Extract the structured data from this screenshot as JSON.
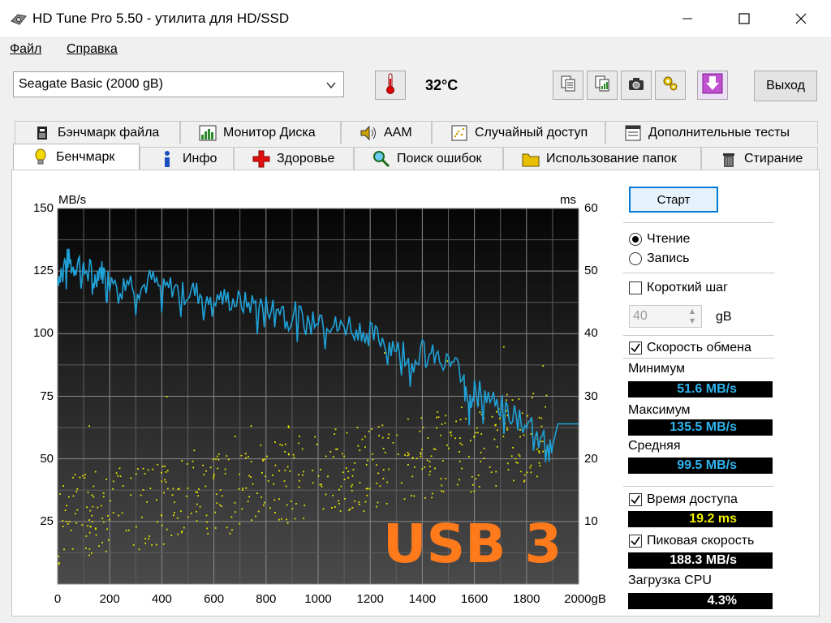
{
  "window": {
    "title": "HD Tune Pro 5.50 - утилита для HD/SSD"
  },
  "menu": {
    "file": "Файл",
    "help": "Справка"
  },
  "toolbar": {
    "drive": "Seagate Basic (2000 gB)",
    "temperature": "32°C",
    "exit": "Выход"
  },
  "tabs_top": [
    {
      "label": "Бэнчмарк файла",
      "icon": "file-benchmark-icon"
    },
    {
      "label": "Монитор Диска",
      "icon": "disk-monitor-icon"
    },
    {
      "label": "AAM",
      "icon": "speaker-icon"
    },
    {
      "label": "Случайный доступ",
      "icon": "random-access-icon"
    },
    {
      "label": "Дополнительные  тесты",
      "icon": "extra-tests-icon"
    }
  ],
  "tabs_bottom": [
    {
      "label": "Бенчмарк",
      "icon": "lightbulb-icon"
    },
    {
      "label": "Инфо",
      "icon": "info-icon"
    },
    {
      "label": "Здоровье",
      "icon": "health-cross-icon"
    },
    {
      "label": "Поиск ошибок",
      "icon": "magnifier-icon"
    },
    {
      "label": "Использование папок",
      "icon": "folder-icon"
    },
    {
      "label": "Стирание",
      "icon": "trash-icon"
    }
  ],
  "controls": {
    "start": "Старт",
    "read": "Чтение",
    "write": "Запись",
    "short_stroke": "Короткий шаг",
    "short_stroke_value": "40",
    "short_stroke_unit": "gB",
    "transfer_rate": "Скорость обмена"
  },
  "stats": {
    "min_label": "Минимум",
    "min": "51.6 MB/s",
    "max_label": "Максимум",
    "max": "135.5 MB/s",
    "avg_label": "Средняя",
    "avg": "99.5 MB/s",
    "access_label": "Время доступа",
    "access": "19.2 ms",
    "burst_label": "Пиковая скорость",
    "burst": "188.3 MB/s",
    "cpu_label": "Загрузка CPU",
    "cpu": "4.3%"
  },
  "watermark": "USB 3",
  "colors": {
    "transfer": "#1fa2d8",
    "access": "#e6e600",
    "chart_bg": "#333333",
    "stat_blue": "#2fb4ee",
    "stat_yellow": "#f0f000",
    "stat_white": "#ffffff"
  },
  "chart_data": {
    "type": "line",
    "y_unit": "MB/s",
    "y2_unit": "ms",
    "x_unit": "gB",
    "ylim": [
      0,
      150
    ],
    "y2lim": [
      0,
      60
    ],
    "xlim": [
      0,
      2000
    ],
    "y_ticks": [
      "150",
      "125",
      "100",
      "75",
      "50",
      "25"
    ],
    "y2_ticks": [
      "60",
      "50",
      "40",
      "30",
      "20",
      "10"
    ],
    "x_ticks": [
      "0",
      "200",
      "400",
      "600",
      "800",
      "1000",
      "1200",
      "1400",
      "1600",
      "1800",
      "2000gB"
    ],
    "grid": true,
    "series": [
      {
        "kind": "transfer",
        "x": [
          0,
          20,
          40,
          60,
          80,
          100,
          120,
          140,
          160,
          180,
          200,
          240,
          280,
          320,
          360,
          400,
          440,
          480,
          520,
          560,
          600,
          640,
          680,
          720,
          760,
          800,
          840,
          880,
          920,
          960,
          1000,
          1040,
          1080,
          1120,
          1160,
          1200,
          1240,
          1280,
          1320,
          1360,
          1400,
          1440,
          1480,
          1520,
          1560,
          1580,
          1600,
          1640,
          1680,
          1720,
          1760,
          1800,
          1840,
          1880,
          1900,
          1920,
          2000
        ],
        "values": [
          122,
          127,
          130,
          126,
          129,
          124,
          127,
          121,
          126,
          124,
          125,
          123,
          121,
          118,
          122,
          117,
          119,
          116,
          117,
          115,
          116,
          114,
          113,
          112,
          112,
          111,
          110,
          110,
          108,
          106,
          108,
          105,
          102,
          104,
          102,
          100,
          98,
          96,
          95,
          91,
          93,
          91,
          89,
          88,
          84,
          73,
          78,
          76,
          72,
          70,
          68,
          66,
          62,
          59,
          55,
          64,
          64
        ]
      },
      {
        "kind": "access",
        "note": "scatter",
        "approx_mean_ms": 19.2
      }
    ]
  }
}
